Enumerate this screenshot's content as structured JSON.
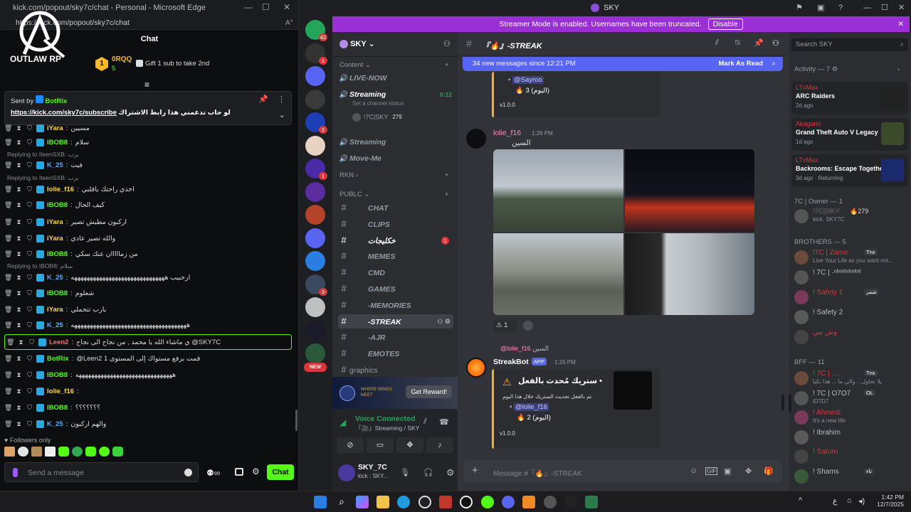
{
  "edge": {
    "title": "kick.com/popout/sky7c/chat - Personal - Microsoft Edge",
    "url": "https://kick.com/popout/sky7c/chat",
    "chat_title": "Chat",
    "logo_text": "OUTLAW RP",
    "leader": {
      "rank": "1",
      "name": "0RQQ",
      "count": "5",
      "gift_text": "Gift 1 sub to take 2nd"
    },
    "pinned": {
      "sent_by_label": "Sent by",
      "sender": "BotRix",
      "link": "https://kick.com/sky7c/subscribe",
      "text": "لو حاب تدعمني هذا رابط الاشتراك"
    },
    "messages": [
      {
        "user": "iYara",
        "text": "مسيين",
        "color": "#ffd54a"
      },
      {
        "user": "IBOB8",
        "text": "سلام",
        "color": "#53fc18"
      },
      {
        "reply": "Replying to IteenSXB: برب"
      },
      {
        "user": "K_25",
        "text": "فيت",
        "color": "#5aa8ff"
      },
      {
        "reply": "Replying to IteenSXB: برب"
      },
      {
        "user": "lolie_f16",
        "text": "اخذي راحتك ياقلبي",
        "color": "#ffd54a"
      },
      {
        "user": "IBOB8",
        "text": "كيف الحال",
        "color": "#53fc18"
      },
      {
        "user": "iYara",
        "text": "اركبون مطيش تصير",
        "color": "#ffd54a"
      },
      {
        "user": "iYara",
        "text": "والله تصير عادي",
        "color": "#ffd54a"
      },
      {
        "user": "IBOB8",
        "text": "من زمااااان عنك سكي",
        "color": "#53fc18"
      },
      {
        "reply": "Replying to IBOB8: سلام"
      },
      {
        "user": "K_25",
        "text": "ارحبيب ههههههههههههههههههههههههههههههه",
        "color": "#5aa8ff"
      },
      {
        "user": "IBOB8",
        "text": "شعلوم",
        "color": "#53fc18"
      },
      {
        "user": "iYara",
        "text": "يارب تتحملي",
        "color": "#ffd54a"
      },
      {
        "user": "K_25",
        "text": "هههههههههههههههههههههههههههههههههههههه",
        "color": "#5aa8ff"
      },
      {
        "user": "Leen2",
        "text": "ي ماشاء الله يا محمد , من نجاح الى نجاح @SKY7C",
        "color": "#ff6b6b",
        "highlight": true
      },
      {
        "user": "BotRix",
        "text": "@Leen2 1 قمت برفع مستواك إلى المستوى",
        "color": "#53fc18"
      },
      {
        "user": "IBOB8",
        "text": "هههههههههههههههههههههههههههههههه",
        "color": "#53fc18"
      },
      {
        "user": "lolie_f16",
        "text": "",
        "color": "#ffd54a"
      },
      {
        "user": "IBOB8",
        "text": "؟؟؟؟؟؟؟",
        "color": "#53fc18"
      },
      {
        "user": "K_25",
        "text": "والهم اركبون",
        "color": "#5aa8ff"
      }
    ],
    "followers_only": "Followers only",
    "input_placeholder": "Send a message",
    "chat_button": "Chat"
  },
  "discord": {
    "window_title": "SKY",
    "banner_text": "Streamer Mode is enabled. Usernames have been truncated.",
    "banner_button": "Disable",
    "server_name": "SKY",
    "channel_header": "『🔥』-STREAK",
    "search_placeholder": "Search SKY",
    "new_messages": "34 new messages since 12:21 PM",
    "mark_as_read": "Mark As Read",
    "categories": {
      "content": "Content",
      "rkn": "RKN",
      "public": "PUBLC"
    },
    "voice_channels": [
      {
        "name": "LIVE-NOW"
      },
      {
        "name": "Streaming",
        "timer": "0:12",
        "status": "Set a channel status",
        "member": "!7C|SKY",
        "member_count": "279"
      },
      {
        "name": "Streaming"
      },
      {
        "name": "Move-Me"
      }
    ],
    "text_channels": [
      "CHAT",
      "CLIPS",
      "خكليجات",
      "MEMES",
      "CMD",
      "GAMES",
      "-MEMORIES",
      "-STREAK",
      "-AJR",
      "EMOTES",
      "graphics"
    ],
    "unread_badge": "1",
    "promo_button": "Get Reward!",
    "voice": {
      "connected": "Voice Connected",
      "channel": "『🎥』Streaming / SKY"
    },
    "user": {
      "name": "SKY_7C",
      "status": "kick : SKY..."
    },
    "chat": {
      "top_embed": {
        "mention": "@Sayroo",
        "count": "3 (اليوم)",
        "version": "v1.0.0"
      },
      "msg1": {
        "author": "lolie_f16",
        "tag": "ʎ",
        "time": "1:26 PM",
        "text": "السين",
        "reaction_count": "1"
      },
      "msg2": {
        "reply_author": "@lolie_f16",
        "reply_text": "السين",
        "author": "StreakBot",
        "app_tag": "APP",
        "time": "1:26 PM",
        "embed_title": "ستريك مُحدث بالفعل •",
        "embed_text": "تم بالفعل تحديث الستريك خلال هذا اليوم",
        "mention": "@lolie_f16",
        "count": "2 (اليوم)",
        "version": "v1.0.0"
      },
      "composer_placeholder": "Message #『🔥』-STREAK"
    },
    "members": {
      "activity_header": "Activity — 7",
      "activities": [
        {
          "user": "LTxMax",
          "game": "ARC Raiders",
          "time": "2d ago"
        },
        {
          "user": "Akagami",
          "game": "Grand Theft Auto V Legacy",
          "time": "1d ago"
        },
        {
          "user": "LTxMax",
          "game": "Backrooms: Escape Together",
          "time": "3d ago · Returning"
        }
      ],
      "owner_header": "7C | Owner — 1",
      "owner": {
        "name": "!7C|SKY",
        "count": "279",
        "status": "kick: SKY7C"
      },
      "brothers_header": "BROTHERS — 5",
      "brothers": [
        {
          "name": "!7C | Zame",
          "tag": "Tnx",
          "status": "Live Your Life as you want not..."
        },
        {
          "name": "! 7C | ·ᵒᵇᵒᵈᵒᵈᵒᵈᵒᵈ"
        },
        {
          "name": "! Safety 1",
          "tag": "شمر"
        },
        {
          "name": "! Safety 2"
        },
        {
          "name": "وش تبي"
        }
      ],
      "bff_header": "BFF — 11",
      "bffs": [
        {
          "name": "! 7C | ....",
          "tag": "Tnx",
          "status": "يلا نحاول... والي ما ... هذا بكيا"
        },
        {
          "name": "! 7C | O7O7",
          "tag": "OL",
          "status": "iD7D7"
        },
        {
          "name": "! Ahmedi",
          "status": "It's a new life"
        },
        {
          "name": "! Ibrahim"
        },
        {
          "name": "! Saturn"
        },
        {
          "name": "! Shams",
          "tag": "تاء"
        }
      ]
    }
  },
  "taskbar": {
    "time": "1:42 PM",
    "date": "12/7/2025",
    "lang": "ع"
  }
}
